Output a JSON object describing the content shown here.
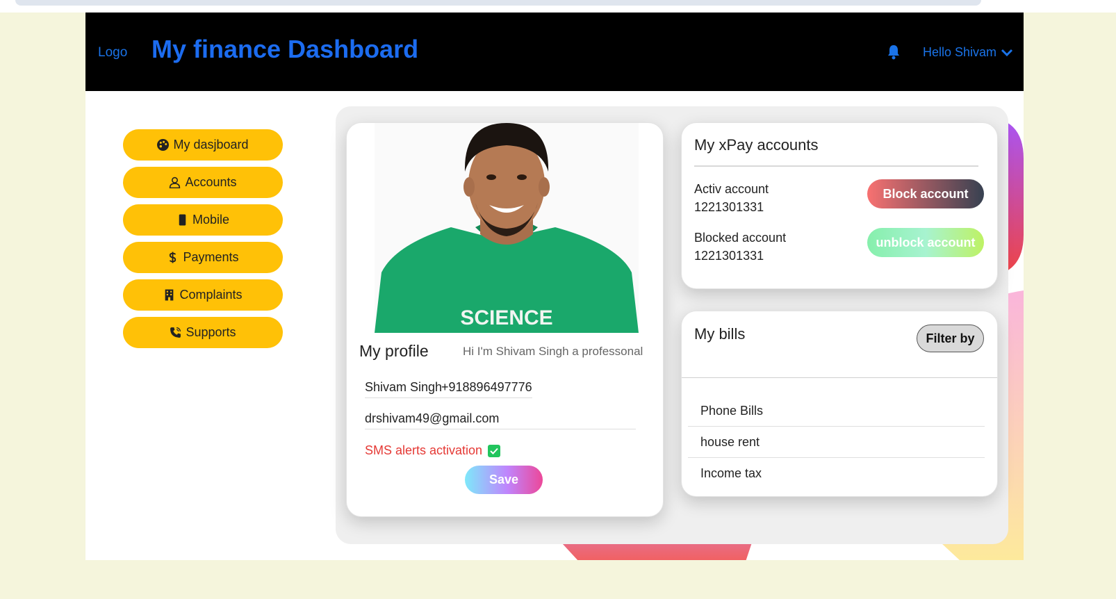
{
  "header": {
    "logo": "Logo",
    "title": "My finance Dashboard",
    "notification_icon": "bell-icon",
    "user_greeting": "Hello Shivam",
    "user_menu_icon": "chevron-down-icon"
  },
  "sidebar": {
    "items": [
      {
        "label": "My dasjboard",
        "icon": "palette-icon"
      },
      {
        "label": "Accounts",
        "icon": "person-icon"
      },
      {
        "label": "Mobile",
        "icon": "phone-icon"
      },
      {
        "label": "Payments",
        "icon": "dollar-icon"
      },
      {
        "label": "Complaints",
        "icon": "building-icon"
      },
      {
        "label": "Supports",
        "icon": "phone-call-icon"
      }
    ]
  },
  "profile": {
    "title": "My profile",
    "bio": "Hi I'm Shivam Singh a professonal",
    "name": "Shivam Singh",
    "phone": "+918896497776",
    "email": "drshivam49@gmail.com",
    "sms_label": "SMS alerts activation",
    "sms_checked": true,
    "save_label": "Save"
  },
  "accounts": {
    "title": "My xPay accounts",
    "active_label": "Activ account",
    "active_number": "1221301331",
    "block_label": "Block account",
    "blocked_label": "Blocked account",
    "blocked_number": "1221301331",
    "unblock_label": "unblock account"
  },
  "bills": {
    "title": "My bills",
    "filter_label": "Filter by",
    "items": [
      "Phone Bills",
      "house rent",
      "Income tax"
    ]
  },
  "colors": {
    "accent_blue": "#1c6cf0",
    "nav_yellow": "#ffc107",
    "header_black": "#000000",
    "page_cream": "#f5f5dc",
    "sms_red": "#e53935",
    "check_green": "#22c55e"
  }
}
